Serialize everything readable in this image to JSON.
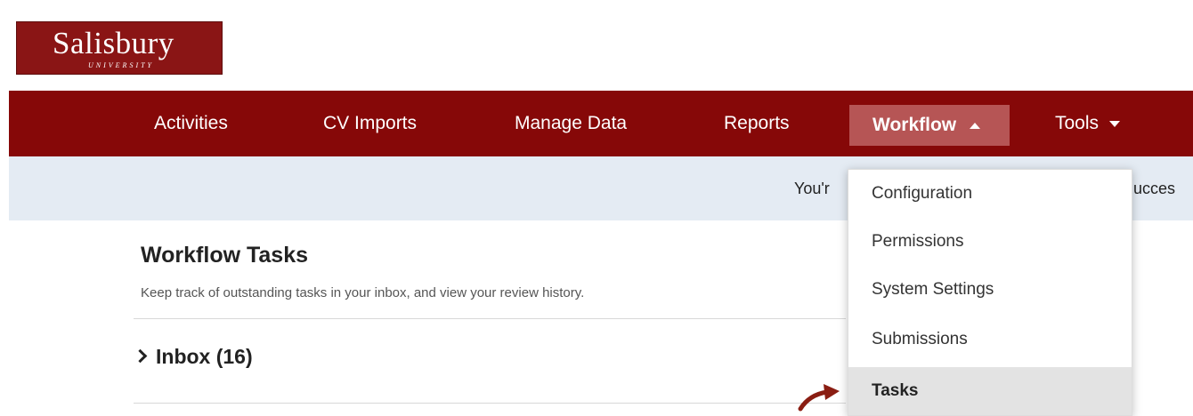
{
  "logo": {
    "name": "Salisbury",
    "subtitle": "UNIVERSITY"
  },
  "nav": {
    "items": [
      "Activities",
      "CV Imports",
      "Manage Data",
      "Reports"
    ],
    "active": "Workflow",
    "tools": "Tools"
  },
  "banner": {
    "left_text": "You'r",
    "right_text": "ucces"
  },
  "page": {
    "title": "Workflow Tasks",
    "description": "Keep track of outstanding tasks in your inbox, and view your review history.",
    "inbox_label": "Inbox (16)"
  },
  "dropdown": {
    "items": [
      "Configuration",
      "Permissions",
      "System Settings",
      "Submissions",
      "Tasks"
    ],
    "selected": "Tasks"
  },
  "colors": {
    "brand": "#860808",
    "active_tab": "#b65555",
    "banner": "#e4ebf3",
    "arrow": "#8a1d12"
  },
  "icons": {
    "workflow_caret": "caret-up-icon",
    "tools_caret": "caret-down-icon",
    "inbox_toggle": "chevron-right-icon",
    "pointer": "curved-arrow-icon"
  }
}
